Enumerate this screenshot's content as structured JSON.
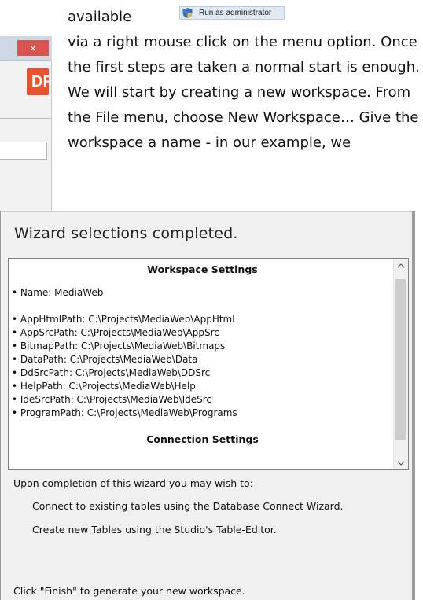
{
  "document": {
    "first_word": "available",
    "paragraph": "via a right mouse click on the menu option. Once the first steps are taken a normal start is enough. We will start by creating a new workspace. From the File menu, choose New Workspace… Give the workspace a name - in our example, we"
  },
  "context_menu": {
    "run_as_admin": "Run as administrator",
    "icon": "uac-shield-icon"
  },
  "background_window": {
    "close_symbol": "×",
    "logo_text": "DF",
    "logo_color": "#e8532d"
  },
  "wizard": {
    "heading": "Wizard selections completed.",
    "summary": {
      "workspace_title": "Workspace Settings",
      "name_line": "• Name:  MediaWeb",
      "paths": [
        "• AppHtmlPath:  C:\\Projects\\MediaWeb\\AppHtml",
        "• AppSrcPath:  C:\\Projects\\MediaWeb\\AppSrc",
        "• BitmapPath:  C:\\Projects\\MediaWeb\\Bitmaps",
        "• DataPath:  C:\\Projects\\MediaWeb\\Data",
        "• DdSrcPath:  C:\\Projects\\MediaWeb\\DDSrc",
        "• HelpPath:  C:\\Projects\\MediaWeb\\Help",
        "• IdeSrcPath:  C:\\Projects\\MediaWeb\\IdeSrc",
        "• ProgramPath:  C:\\Projects\\MediaWeb\\Programs"
      ],
      "connection_title": "Connection Settings"
    },
    "upon_completion": "Upon completion of this wizard you may wish to:",
    "options": [
      "Connect to existing tables using the Database Connect Wizard.",
      "Create new Tables using the Studio's Table-Editor."
    ],
    "finish_hint": "Click \"Finish\" to generate your new workspace."
  }
}
